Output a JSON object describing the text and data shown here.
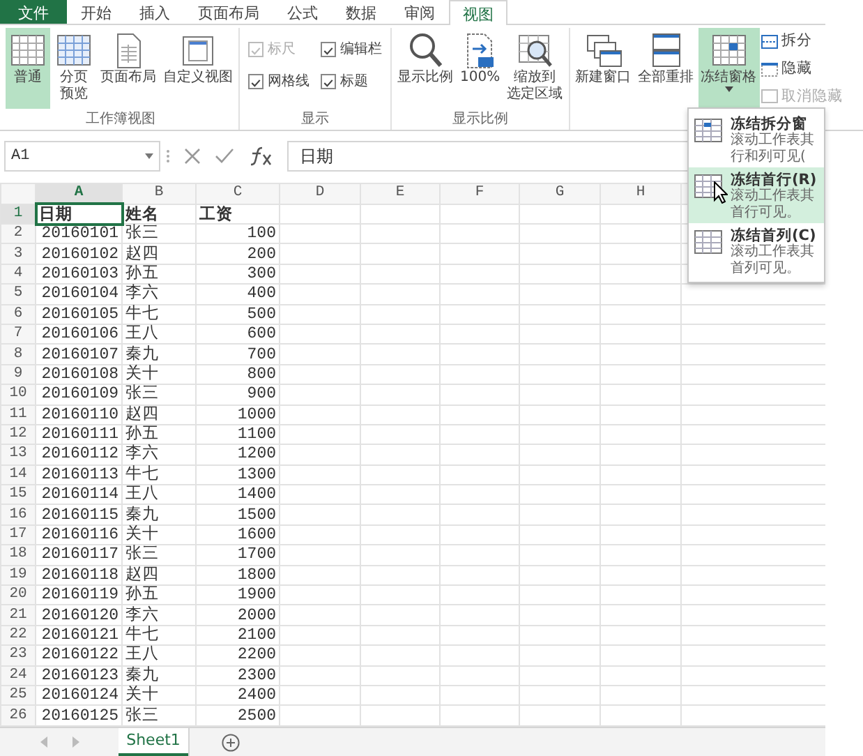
{
  "ribbon_tabs": [
    {
      "label": "文件",
      "kind": "file",
      "selected": false
    },
    {
      "label": "开始",
      "kind": "tab",
      "selected": false
    },
    {
      "label": "插入",
      "kind": "tab",
      "selected": false
    },
    {
      "label": "页面布局",
      "kind": "tab",
      "selected": false
    },
    {
      "label": "公式",
      "kind": "tab",
      "selected": false
    },
    {
      "label": "数据",
      "kind": "tab",
      "selected": false
    },
    {
      "label": "审阅",
      "kind": "tab",
      "selected": false
    },
    {
      "label": "视图",
      "kind": "tab",
      "selected": true
    }
  ],
  "ribbon_groups": [
    {
      "label": "工作簿视图",
      "buttons": [
        {
          "label_lines": [
            "普通"
          ],
          "selected": true
        },
        {
          "label_lines": [
            "分页",
            "预览"
          ],
          "selected": false
        },
        {
          "label_lines": [
            "页面布局"
          ],
          "selected": false
        },
        {
          "label_lines": [
            "自定义视图"
          ],
          "selected": false
        }
      ]
    },
    {
      "label": "显示",
      "checkboxes": [
        {
          "label": "标尺",
          "checked": true,
          "disabled": true
        },
        {
          "label": "编辑栏",
          "checked": true,
          "disabled": false
        },
        {
          "label": "网格线",
          "checked": true,
          "disabled": false
        },
        {
          "label": "标题",
          "checked": true,
          "disabled": false
        }
      ]
    },
    {
      "label": "显示比例",
      "buttons": [
        {
          "label_lines": [
            "显示比例"
          ],
          "selected": false
        },
        {
          "label_lines": [
            "100%"
          ],
          "selected": false
        },
        {
          "label_lines": [
            "缩放到",
            "选定区域"
          ],
          "selected": false
        }
      ]
    },
    {
      "buttons": [
        {
          "label_lines": [
            "新建窗口"
          ],
          "selected": false
        },
        {
          "label_lines": [
            "全部重排"
          ],
          "selected": false
        },
        {
          "label_lines": [
            "冻结窗格"
          ],
          "selected": true,
          "dropdown": true
        }
      ],
      "small_buttons": [
        {
          "label": "拆分",
          "disabled": false
        },
        {
          "label": "隐藏",
          "disabled": false
        },
        {
          "label": "取消隐藏",
          "disabled": true
        }
      ]
    }
  ],
  "formula_bar": {
    "name_box": "A1",
    "formula": "日期"
  },
  "sheet": {
    "columns": [
      {
        "label": "A",
        "selected": true
      },
      {
        "label": "B",
        "selected": false
      },
      {
        "label": "C",
        "selected": false
      },
      {
        "label": "D",
        "selected": false
      },
      {
        "label": "E",
        "selected": false
      },
      {
        "label": "F",
        "selected": false
      },
      {
        "label": "G",
        "selected": false
      },
      {
        "label": "H",
        "selected": false
      }
    ],
    "rows": [
      {
        "number": "1",
        "kind": "header",
        "selected": true,
        "cells": [
          "日期",
          "姓名",
          "工资"
        ]
      },
      {
        "number": "2",
        "kind": "data",
        "selected": false,
        "cells": [
          "20160101",
          "张三",
          "100"
        ]
      },
      {
        "number": "3",
        "kind": "data",
        "selected": false,
        "cells": [
          "20160102",
          "赵四",
          "200"
        ]
      },
      {
        "number": "4",
        "kind": "data",
        "selected": false,
        "cells": [
          "20160103",
          "孙五",
          "300"
        ]
      },
      {
        "number": "5",
        "kind": "data",
        "selected": false,
        "cells": [
          "20160104",
          "李六",
          "400"
        ]
      },
      {
        "number": "6",
        "kind": "data",
        "selected": false,
        "cells": [
          "20160105",
          "牛七",
          "500"
        ]
      },
      {
        "number": "7",
        "kind": "data",
        "selected": false,
        "cells": [
          "20160106",
          "王八",
          "600"
        ]
      },
      {
        "number": "8",
        "kind": "data",
        "selected": false,
        "cells": [
          "20160107",
          "秦九",
          "700"
        ]
      },
      {
        "number": "9",
        "kind": "data",
        "selected": false,
        "cells": [
          "20160108",
          "关十",
          "800"
        ]
      },
      {
        "number": "10",
        "kind": "data",
        "selected": false,
        "cells": [
          "20160109",
          "张三",
          "900"
        ]
      },
      {
        "number": "11",
        "kind": "data",
        "selected": false,
        "cells": [
          "20160110",
          "赵四",
          "1000"
        ]
      },
      {
        "number": "12",
        "kind": "data",
        "selected": false,
        "cells": [
          "20160111",
          "孙五",
          "1100"
        ]
      },
      {
        "number": "13",
        "kind": "data",
        "selected": false,
        "cells": [
          "20160112",
          "李六",
          "1200"
        ]
      },
      {
        "number": "14",
        "kind": "data",
        "selected": false,
        "cells": [
          "20160113",
          "牛七",
          "1300"
        ]
      },
      {
        "number": "15",
        "kind": "data",
        "selected": false,
        "cells": [
          "20160114",
          "王八",
          "1400"
        ]
      },
      {
        "number": "16",
        "kind": "data",
        "selected": false,
        "cells": [
          "20160115",
          "秦九",
          "1500"
        ]
      },
      {
        "number": "17",
        "kind": "data",
        "selected": false,
        "cells": [
          "20160116",
          "关十",
          "1600"
        ]
      },
      {
        "number": "18",
        "kind": "data",
        "selected": false,
        "cells": [
          "20160117",
          "张三",
          "1700"
        ]
      },
      {
        "number": "19",
        "kind": "data",
        "selected": false,
        "cells": [
          "20160118",
          "赵四",
          "1800"
        ]
      },
      {
        "number": "20",
        "kind": "data",
        "selected": false,
        "cells": [
          "20160119",
          "孙五",
          "1900"
        ]
      },
      {
        "number": "21",
        "kind": "data",
        "selected": false,
        "cells": [
          "20160120",
          "李六",
          "2000"
        ]
      },
      {
        "number": "22",
        "kind": "data",
        "selected": false,
        "cells": [
          "20160121",
          "牛七",
          "2100"
        ]
      },
      {
        "number": "23",
        "kind": "data",
        "selected": false,
        "cells": [
          "20160122",
          "王八",
          "2200"
        ]
      },
      {
        "number": "24",
        "kind": "data",
        "selected": false,
        "cells": [
          "20160123",
          "秦九",
          "2300"
        ]
      },
      {
        "number": "25",
        "kind": "data",
        "selected": false,
        "cells": [
          "20160124",
          "关十",
          "2400"
        ]
      },
      {
        "number": "26",
        "kind": "data",
        "selected": false,
        "cells": [
          "20160125",
          "张三",
          "2500"
        ]
      }
    ]
  },
  "freeze_menu": {
    "items": [
      {
        "title": "冻结拆分窗",
        "description_lines": [
          "滚动工作表其",
          "行和列可见("
        ],
        "selected": false
      },
      {
        "title": "冻结首行(R)",
        "description_lines": [
          "滚动工作表其",
          "首行可见。"
        ],
        "selected": true
      },
      {
        "title": "冻结首列(C)",
        "description_lines": [
          "滚动工作表其",
          "首列可见。"
        ],
        "selected": false
      }
    ]
  },
  "sheet_tabs": [
    {
      "label": "Sheet1",
      "selected": true
    }
  ]
}
